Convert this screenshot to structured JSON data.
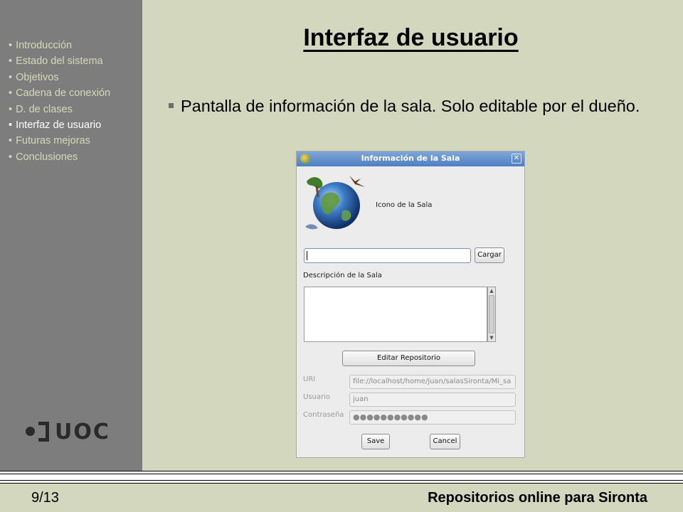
{
  "sidebar": {
    "items": [
      {
        "label": "Introducción"
      },
      {
        "label": "Estado del sistema"
      },
      {
        "label": "Objetivos"
      },
      {
        "label": "Cadena de conexión"
      },
      {
        "label": "D. de clases"
      },
      {
        "label": "Interfaz de usuario",
        "active": true
      },
      {
        "label": "Futuras mejoras"
      },
      {
        "label": "Conclusiones"
      }
    ],
    "bullet": "•",
    "logo_text": "UOC",
    "text_color": "#d6d9b8",
    "active_color": "#ffffff"
  },
  "slide": {
    "title": "Interfaz de usuario",
    "bullet_text": "Pantalla de información de la sala. Solo editable por el dueño."
  },
  "dialog": {
    "title": "Información de la Sala",
    "close_glyph": "✕",
    "icon_label": "Icono de la Sala",
    "url_value": "",
    "load_button": "Cargar",
    "description_label": "Descripción de la Sala",
    "description_value": "",
    "edit_repo_button": "Editar Repositorio",
    "uri_label": "URI",
    "uri_value": "file://localhost/home/juan/salasSironta/Mi_sa",
    "user_label": "Usuario",
    "user_value": "juan",
    "password_label": "Contraseña",
    "password_value": "●●●●●●●●●●●",
    "save_button": "Save",
    "cancel_button": "Cancel"
  },
  "footer": {
    "page": "9/13",
    "title": "Repositorios online para Sironta"
  },
  "colors": {
    "background": "#d3d7bd",
    "sidebar": "#7d7d7d",
    "titlebar": "#4e7fc3"
  }
}
